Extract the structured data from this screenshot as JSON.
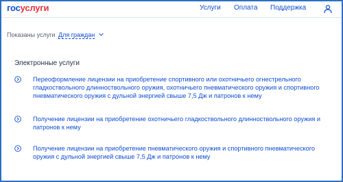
{
  "header": {
    "logo_part1": "гос",
    "logo_part2": "услуги",
    "nav": [
      "Услуги",
      "Оплата",
      "Поддержка"
    ]
  },
  "filter": {
    "label": "Показаны услуги",
    "selected": "Для граждан"
  },
  "section": {
    "title": "Электронные услуги",
    "items": [
      "Переоформление лицензии на приобретение спортивного или охотничьего огнестрельного гладкоствольного длинноствольного оружия, охотничьего пневматического оружия и спортивного пневматического оружия с дульной энергией свыше 7,5 Дж и патронов к нему",
      "Получение лицензии на приобретение охотничьего гладкоствольного длинноствольного оружия и патронов к нему",
      "Получение лицензии на приобретение пневматического оружия и спортивного пневматического оружия с дульной энергией свыше 7,5 Дж и патронов к нему"
    ]
  },
  "colors": {
    "link": "#0d4cd3",
    "logo_red": "#e5323c",
    "frame": "#2d6fc4"
  },
  "icons": [
    "user-icon",
    "chevron-down-icon",
    "chevron-right-circle-icon"
  ]
}
